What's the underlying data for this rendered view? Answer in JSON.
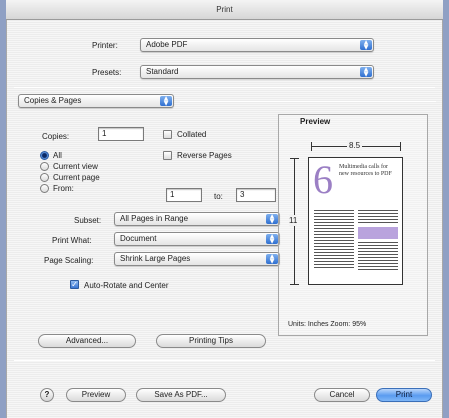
{
  "window": {
    "title": "Print"
  },
  "printer": {
    "label": "Printer:",
    "value": "Adobe PDF"
  },
  "presets": {
    "label": "Presets:",
    "value": "Standard"
  },
  "panel": {
    "value": "Copies & Pages"
  },
  "copies": {
    "label": "Copies:",
    "value": "1"
  },
  "collated": {
    "label": "Collated",
    "checked": false
  },
  "reverse_pages": {
    "label": "Reverse Pages",
    "checked": false
  },
  "range": {
    "options": [
      "All",
      "Current view",
      "Current page",
      "From:"
    ],
    "selected": "All",
    "from_value": "1",
    "to_label": "to:",
    "to_value": "3"
  },
  "subset": {
    "label": "Subset:",
    "value": "All Pages in Range"
  },
  "print_what": {
    "label": "Print What:",
    "value": "Document"
  },
  "page_scaling": {
    "label": "Page Scaling:",
    "value": "Shrink Large Pages"
  },
  "auto_rotate": {
    "label": "Auto-Rotate and Center",
    "checked": true
  },
  "preview": {
    "title": "Preview",
    "width_label": "8.5",
    "height_label": "11",
    "units_text": "Units: Inches  Zoom: 95%",
    "page_number": "6",
    "page_headline": "Multimedia calls for new resources to PDF"
  },
  "buttons": {
    "advanced": "Advanced...",
    "printing_tips": "Printing Tips",
    "help": "?",
    "preview": "Preview",
    "save_as_pdf": "Save As PDF...",
    "cancel": "Cancel",
    "print": "Print"
  },
  "colors": {
    "accent": "#3a76d4",
    "page_number": "#9b7fc4",
    "highlight": "#b9a3dd"
  }
}
